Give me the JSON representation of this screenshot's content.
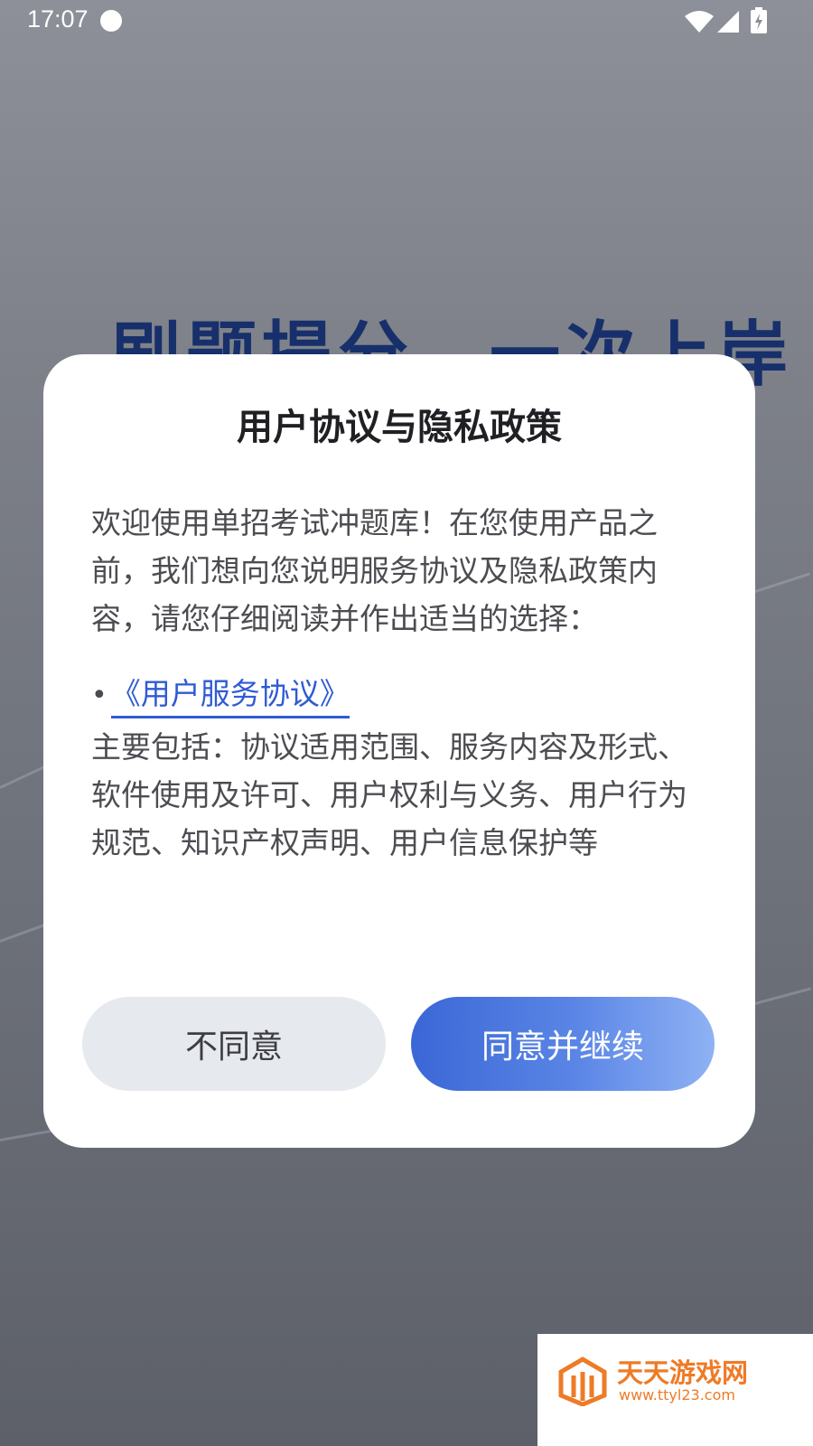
{
  "status_bar": {
    "time": "17:07",
    "face_icon": "cat-face-icon",
    "wifi_icon": "wifi-icon",
    "signal_icon": "cell-signal-icon",
    "battery_icon": "battery-charging-icon"
  },
  "background": {
    "hero_text": "刷题提分，一次上岸"
  },
  "dialog": {
    "title": "用户协议与隐私政策",
    "intro": "欢迎使用单招考试冲题库！在您使用产品之前，我们想向您说明服务协议及隐私政策内容，请您仔细阅读并作出适当的选择：",
    "bullet": "•",
    "link_label": "《用户服务协议》",
    "summary": "主要包括：协议适用范围、服务内容及形式、软件使用及许可、用户权利与义务、用户行为规范、知识产权声明、用户信息保护等",
    "disagree_label": "不同意",
    "agree_label": "同意并继续",
    "accent_color": "#2f5bd4"
  },
  "watermark": {
    "title": "天天游戏网",
    "url": "www.ttyl23.com",
    "logo_icon": "ttyl-logo-icon",
    "color": "#ee7b27"
  }
}
